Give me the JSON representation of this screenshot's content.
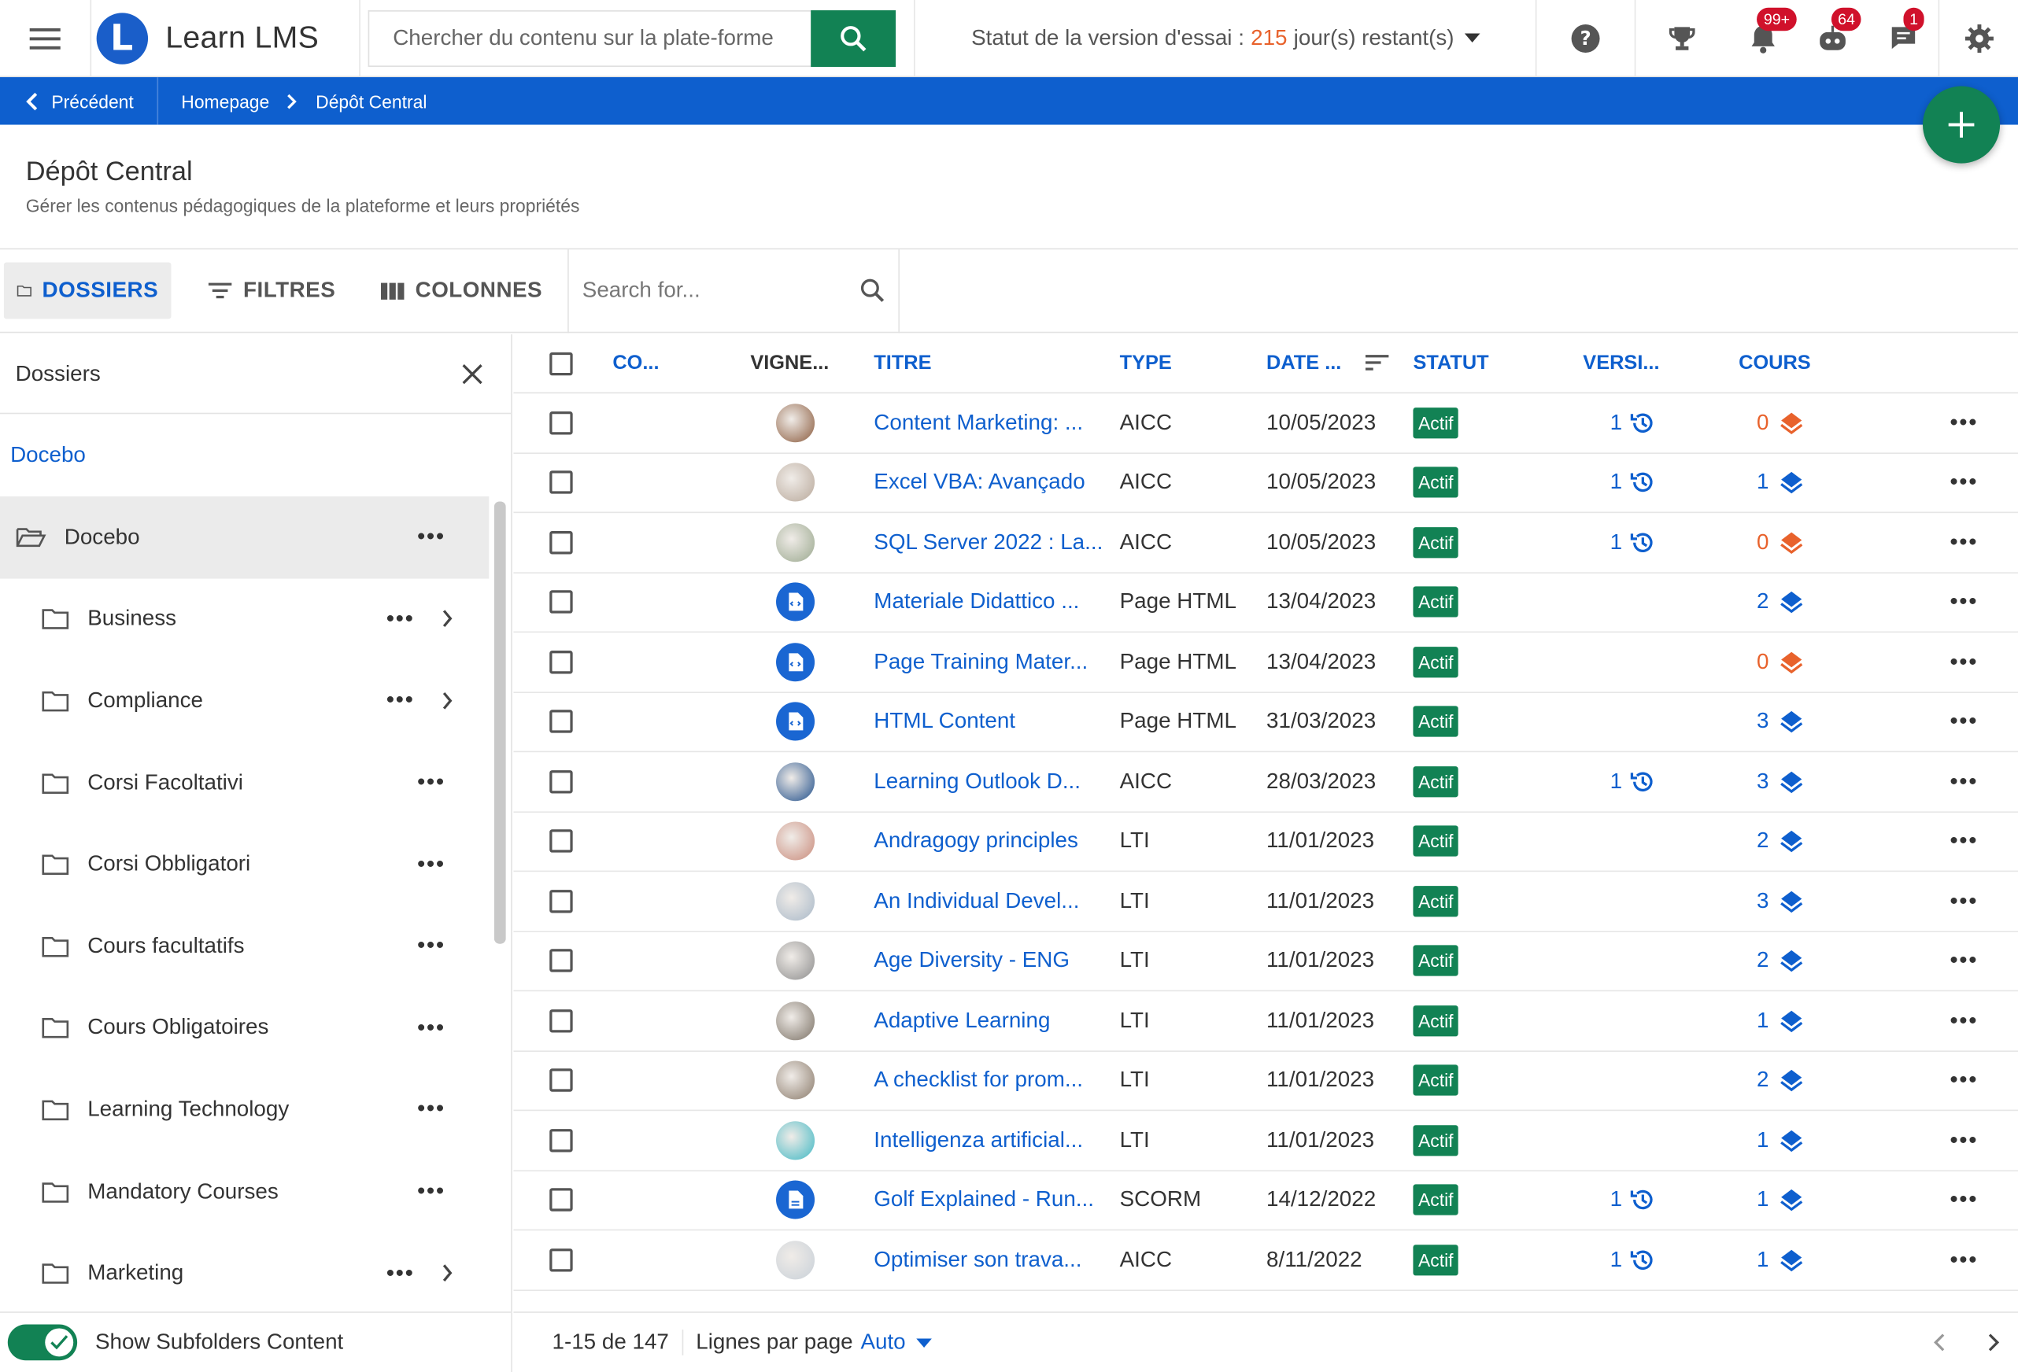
{
  "app": {
    "name": "Learn LMS",
    "search_placeholder": "Chercher du contenu sur la plate-forme",
    "trial_prefix": "Statut de la version d'essai :",
    "trial_days": "215",
    "trial_suffix": "jour(s) restant(s)",
    "badges": {
      "notifications": "99+",
      "assistant": "64",
      "messages": "1"
    }
  },
  "breadcrumb": {
    "back": "Précédent",
    "home": "Homepage",
    "current": "Dépôt Central"
  },
  "page": {
    "title": "Dépôt Central",
    "subtitle": "Gérer les contenus pédagogiques de la plateforme et leurs propriétés"
  },
  "toolbar": {
    "folders": "DOSSIERS",
    "filters": "FILTRES",
    "columns": "COLONNES",
    "search_placeholder": "Search for..."
  },
  "sidebar": {
    "title": "Dossiers",
    "root": "Docebo",
    "folders": [
      {
        "label": "Docebo",
        "selected": true,
        "children": false
      },
      {
        "label": "Business",
        "selected": false,
        "children": true
      },
      {
        "label": "Compliance",
        "selected": false,
        "children": true
      },
      {
        "label": "Corsi Facoltativi",
        "selected": false,
        "children": false
      },
      {
        "label": "Corsi Obbligatori",
        "selected": false,
        "children": false
      },
      {
        "label": "Cours facultatifs",
        "selected": false,
        "children": false
      },
      {
        "label": "Cours Obligatoires",
        "selected": false,
        "children": false
      },
      {
        "label": "Learning Technology",
        "selected": false,
        "children": false
      },
      {
        "label": "Mandatory Courses",
        "selected": false,
        "children": false
      },
      {
        "label": "Marketing",
        "selected": false,
        "children": true
      }
    ],
    "subfolders_label": "Show Subfolders Content"
  },
  "table": {
    "columns": {
      "code": "CO...",
      "thumb": "VIGNE...",
      "title": "TITRE",
      "type": "TYPE",
      "date": "DATE ...",
      "status": "STATUT",
      "version": "VERSI...",
      "courses": "COURS"
    },
    "rows": [
      {
        "title": "Content Marketing: ...",
        "type": "AICC",
        "date": "10/05/2023",
        "status": "Actif",
        "version": "1",
        "courses": "0",
        "thumb": "photo",
        "tcolor": "#8a5a3c"
      },
      {
        "title": "Excel VBA: Avançado",
        "type": "AICC",
        "date": "10/05/2023",
        "status": "Actif",
        "version": "1",
        "courses": "1",
        "thumb": "photo",
        "tcolor": "#b8a89a"
      },
      {
        "title": "SQL Server 2022 : La...",
        "type": "AICC",
        "date": "10/05/2023",
        "status": "Actif",
        "version": "1",
        "courses": "0",
        "thumb": "photo",
        "tcolor": "#9aa88e"
      },
      {
        "title": "Materiale Didattico ...",
        "type": "Page HTML",
        "date": "13/04/2023",
        "status": "Actif",
        "version": "",
        "courses": "2",
        "thumb": "html",
        "tcolor": "#1a66d2"
      },
      {
        "title": "Page Training Mater...",
        "type": "Page HTML",
        "date": "13/04/2023",
        "status": "Actif",
        "version": "",
        "courses": "0",
        "thumb": "html",
        "tcolor": "#1a66d2"
      },
      {
        "title": "HTML Content",
        "type": "Page HTML",
        "date": "31/03/2023",
        "status": "Actif",
        "version": "",
        "courses": "3",
        "thumb": "html",
        "tcolor": "#1a66d2"
      },
      {
        "title": "Learning Outlook D...",
        "type": "AICC",
        "date": "28/03/2023",
        "status": "Actif",
        "version": "1",
        "courses": "3",
        "thumb": "photo",
        "tcolor": "#1f4e8a"
      },
      {
        "title": "Andragogy principles",
        "type": "LTI",
        "date": "11/01/2023",
        "status": "Actif",
        "version": "",
        "courses": "2",
        "thumb": "photo",
        "tcolor": "#c98a7a"
      },
      {
        "title": "An Individual Devel...",
        "type": "LTI",
        "date": "11/01/2023",
        "status": "Actif",
        "version": "",
        "courses": "3",
        "thumb": "photo",
        "tcolor": "#a8b8c8"
      },
      {
        "title": "Age Diversity - ENG",
        "type": "LTI",
        "date": "11/01/2023",
        "status": "Actif",
        "version": "",
        "courses": "2",
        "thumb": "photo",
        "tcolor": "#8c8c8c"
      },
      {
        "title": "Adaptive Learning",
        "type": "LTI",
        "date": "11/01/2023",
        "status": "Actif",
        "version": "",
        "courses": "1",
        "thumb": "photo",
        "tcolor": "#7a7064"
      },
      {
        "title": "A checklist for prom...",
        "type": "LTI",
        "date": "11/01/2023",
        "status": "Actif",
        "version": "",
        "courses": "2",
        "thumb": "photo",
        "tcolor": "#8a7a6a"
      },
      {
        "title": "Intelligenza artificial...",
        "type": "LTI",
        "date": "11/01/2023",
        "status": "Actif",
        "version": "",
        "courses": "1",
        "thumb": "photo",
        "tcolor": "#3fb8c4"
      },
      {
        "title": "Golf Explained - Run...",
        "type": "SCORM",
        "date": "14/12/2022",
        "status": "Actif",
        "version": "1",
        "courses": "1",
        "thumb": "file",
        "tcolor": "#1a66d2"
      },
      {
        "title": "Optimiser son trava...",
        "type": "AICC",
        "date": "8/11/2022",
        "status": "Actif",
        "version": "1",
        "courses": "1",
        "thumb": "photo",
        "tcolor": "#c8d0d8"
      }
    ]
  },
  "footer": {
    "range": "1-15 de 147",
    "rows_per_page_label": "Lignes par page",
    "rows_per_page_value": "Auto"
  },
  "colors": {
    "primary": "#0e5fce",
    "green": "#128254",
    "orange": "#e8622c",
    "badge": "#d0112b"
  }
}
